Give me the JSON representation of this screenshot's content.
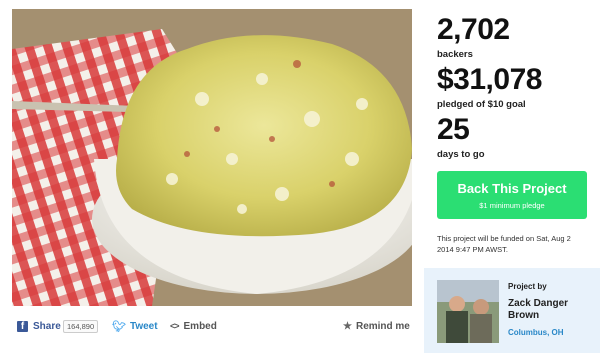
{
  "media": {
    "alt_icon": "project-image"
  },
  "stats": {
    "backers_count": "2,702",
    "backers_label": "backers",
    "pledged_amount": "$31,078",
    "pledged_label": "pledged of $10 goal",
    "days_count": "25",
    "days_label": "days to go"
  },
  "cta": {
    "title": "Back This Project",
    "subtitle": "$1 minimum pledge"
  },
  "funding_note": "This project will be funded on Sat, Aug 2 2014 9:47 PM AWST.",
  "creator": {
    "by_label": "Project by",
    "name": "Zack Danger Brown",
    "location": "Columbus, OH"
  },
  "share": {
    "facebook_label": "Share",
    "facebook_count": "164,890",
    "tweet_label": "Tweet",
    "embed_label": "Embed",
    "remind_label": "Remind me"
  },
  "colors": {
    "cta_green": "#2bde73",
    "facebook_blue": "#3b5998",
    "link_blue": "#2a88c8",
    "creator_bg": "#e8f2fb"
  }
}
